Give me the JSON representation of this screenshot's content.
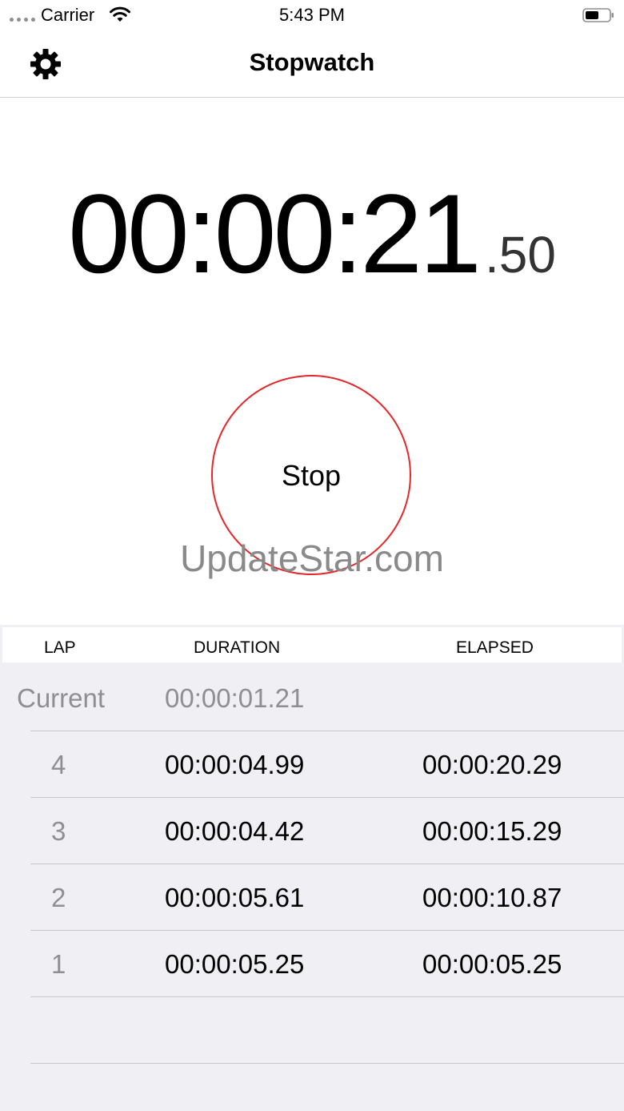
{
  "status_bar": {
    "carrier": "Carrier",
    "time": "5:43 PM"
  },
  "nav": {
    "title": "Stopwatch"
  },
  "timer": {
    "main": "00:00:21",
    "hundredths": ".50"
  },
  "stop_button": {
    "label": "Stop",
    "border_color": "#e3272b"
  },
  "watermark": "UpdateStar.com",
  "laps": {
    "headers": {
      "lap": "LAP",
      "duration": "DURATION",
      "elapsed": "ELAPSED"
    },
    "current": {
      "label": "Current",
      "duration": "00:00:01.21"
    },
    "rows": [
      {
        "lap": "4",
        "duration": "00:00:04.99",
        "elapsed": "00:00:20.29"
      },
      {
        "lap": "3",
        "duration": "00:00:04.42",
        "elapsed": "00:00:15.29"
      },
      {
        "lap": "2",
        "duration": "00:00:05.61",
        "elapsed": "00:00:10.87"
      },
      {
        "lap": "1",
        "duration": "00:00:05.25",
        "elapsed": "00:00:05.25"
      }
    ]
  }
}
